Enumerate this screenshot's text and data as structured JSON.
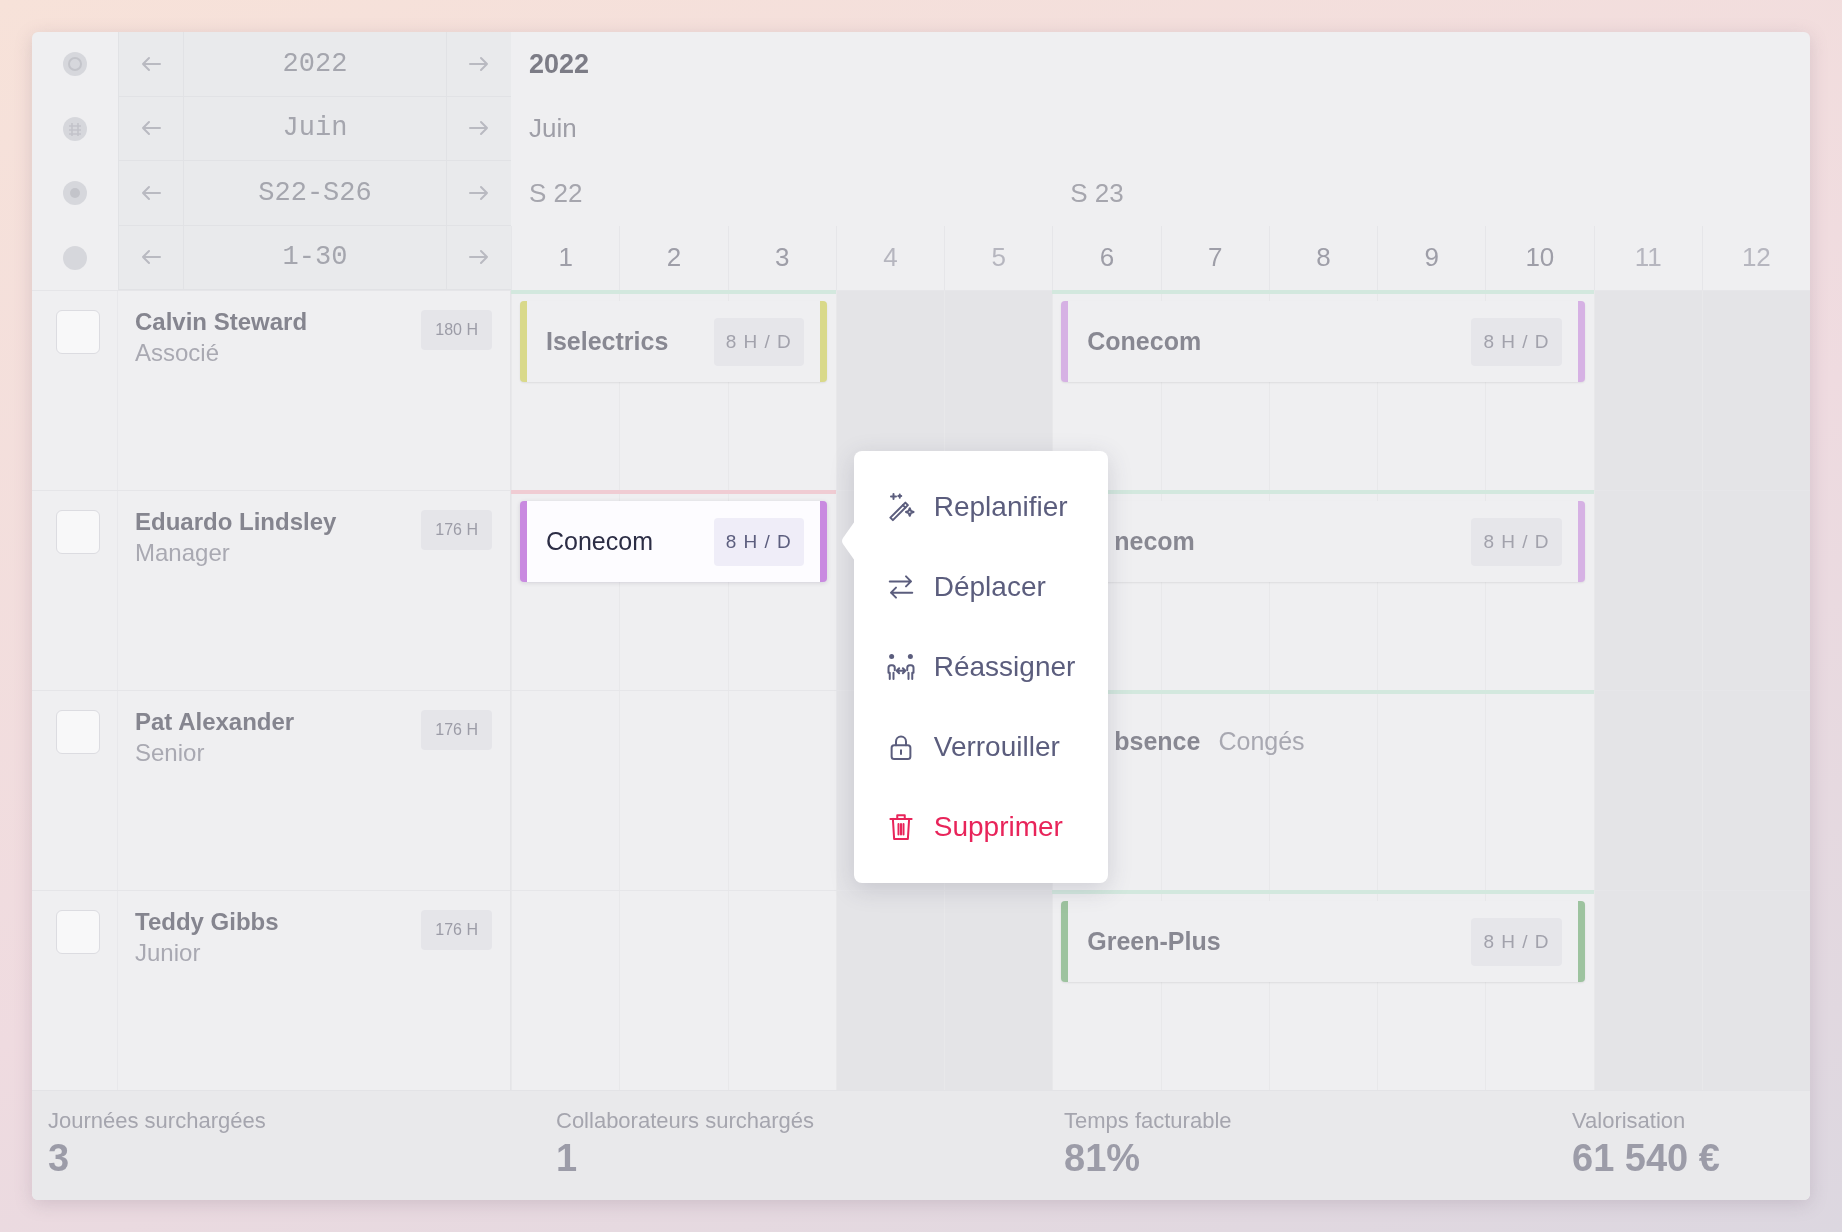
{
  "header": {
    "controls": [
      "2022",
      "Juin",
      "S22-S26",
      "1-30"
    ],
    "year": "2022",
    "month": "Juin",
    "weeks": [
      {
        "label": "S 22",
        "days": [
          {
            "label": "1",
            "weekend": false
          },
          {
            "label": "2",
            "weekend": false
          },
          {
            "label": "3",
            "weekend": false
          },
          {
            "label": "4",
            "weekend": true
          },
          {
            "label": "5",
            "weekend": true
          }
        ]
      },
      {
        "label": "S 23",
        "days": [
          {
            "label": "6",
            "weekend": false
          },
          {
            "label": "7",
            "weekend": false
          },
          {
            "label": "8",
            "weekend": false
          },
          {
            "label": "9",
            "weekend": false
          },
          {
            "label": "10",
            "weekend": false
          },
          {
            "label": "11",
            "weekend": true
          },
          {
            "label": "12",
            "weekend": true
          }
        ]
      }
    ]
  },
  "people": [
    {
      "name": "Calvin Steward",
      "role": "Associé",
      "hours": "180 H",
      "segments": [
        {
          "kind": "assignment",
          "load": {
            "color": "#d3e8de"
          },
          "title": "Iselectrics",
          "rate": "8 H / D",
          "color": "#d9d98a",
          "selected": false
        },
        {
          "kind": "empty"
        },
        {
          "kind": "assignment",
          "load": {
            "color": "#d3e8de"
          },
          "title": "Conecom",
          "rate": "8 H / D",
          "color": "#d6b1e4",
          "selected": false
        },
        {
          "kind": "empty"
        }
      ]
    },
    {
      "name": "Eduardo Lindsley",
      "role": "Manager",
      "hours": "176 H",
      "segments": [
        {
          "kind": "assignment",
          "load": {
            "color": "#f0ccd3"
          },
          "title": "Conecom",
          "rate": "8 H / D",
          "color": "#c98ae0",
          "selected": true
        },
        {
          "kind": "empty"
        },
        {
          "kind": "assignment",
          "load": {
            "color": "#d3e8de"
          },
          "title": "necom",
          "rate": "8 H / D",
          "color": "#d6b1e4",
          "selected": false
        },
        {
          "kind": "empty"
        }
      ]
    },
    {
      "name": "Pat Alexander",
      "role": "Senior",
      "hours": "176 H",
      "segments": [
        {
          "kind": "empty"
        },
        {
          "kind": "empty"
        },
        {
          "kind": "absence",
          "load": {
            "color": "#d3e8de"
          },
          "title": "bsence",
          "detail": "Congés"
        },
        {
          "kind": "empty"
        }
      ]
    },
    {
      "name": "Teddy Gibbs",
      "role": "Junior",
      "hours": "176 H",
      "segments": [
        {
          "kind": "empty"
        },
        {
          "kind": "empty"
        },
        {
          "kind": "assignment",
          "load": {
            "color": "#d3e8de"
          },
          "title": "Green-Plus",
          "rate": "8 H / D",
          "color": "#9dc39f",
          "selected": false
        },
        {
          "kind": "empty"
        }
      ]
    }
  ],
  "context_menu": {
    "items": [
      {
        "label": "Replanifier",
        "danger": false
      },
      {
        "label": "Déplacer",
        "danger": false
      },
      {
        "label": "Réassigner",
        "danger": false
      },
      {
        "label": "Verrouiller",
        "danger": false
      },
      {
        "label": "Supprimer",
        "danger": true
      }
    ]
  },
  "stats": [
    {
      "label": "Journées surchargées",
      "value": "3"
    },
    {
      "label": "Collaborateurs surchargés",
      "value": "1"
    },
    {
      "label": "Temps facturable",
      "value": "81%"
    },
    {
      "label": "Valorisation",
      "value": "61 540 €"
    }
  ]
}
